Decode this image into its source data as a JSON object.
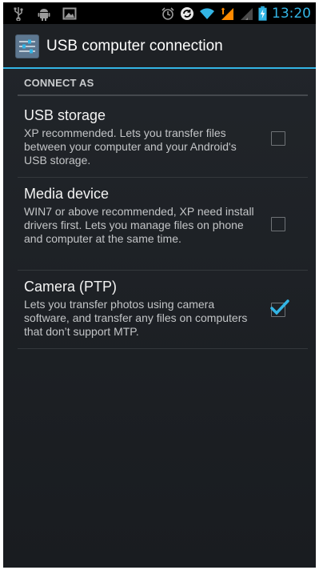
{
  "status_bar": {
    "time": "13:20",
    "left_icons": [
      "usb-icon",
      "android-debug-icon",
      "gallery-notification-icon"
    ],
    "right_icons": [
      "alarm-icon",
      "sync-icon",
      "wifi-icon",
      "signal-strong-icon",
      "signal-weak-icon",
      "battery-charging-icon"
    ],
    "accent_color": "#33b5e5"
  },
  "action_bar": {
    "title": "USB computer connection",
    "icon": "settings-sliders-icon"
  },
  "section": {
    "header": "CONNECT AS"
  },
  "options": [
    {
      "title": "USB storage",
      "summary": "XP recommended. Lets you transfer files between your computer and your Android's USB storage.",
      "checked": false
    },
    {
      "title": "Media device",
      "summary": "WIN7 or above recommended, XP need install drivers first. Lets you manage files on phone and computer at the same time.",
      "checked": false
    },
    {
      "title": "Camera (PTP)",
      "summary": "Lets you transfer photos using camera software, and transfer any files on computers that don’t support MTP.",
      "checked": true
    }
  ]
}
